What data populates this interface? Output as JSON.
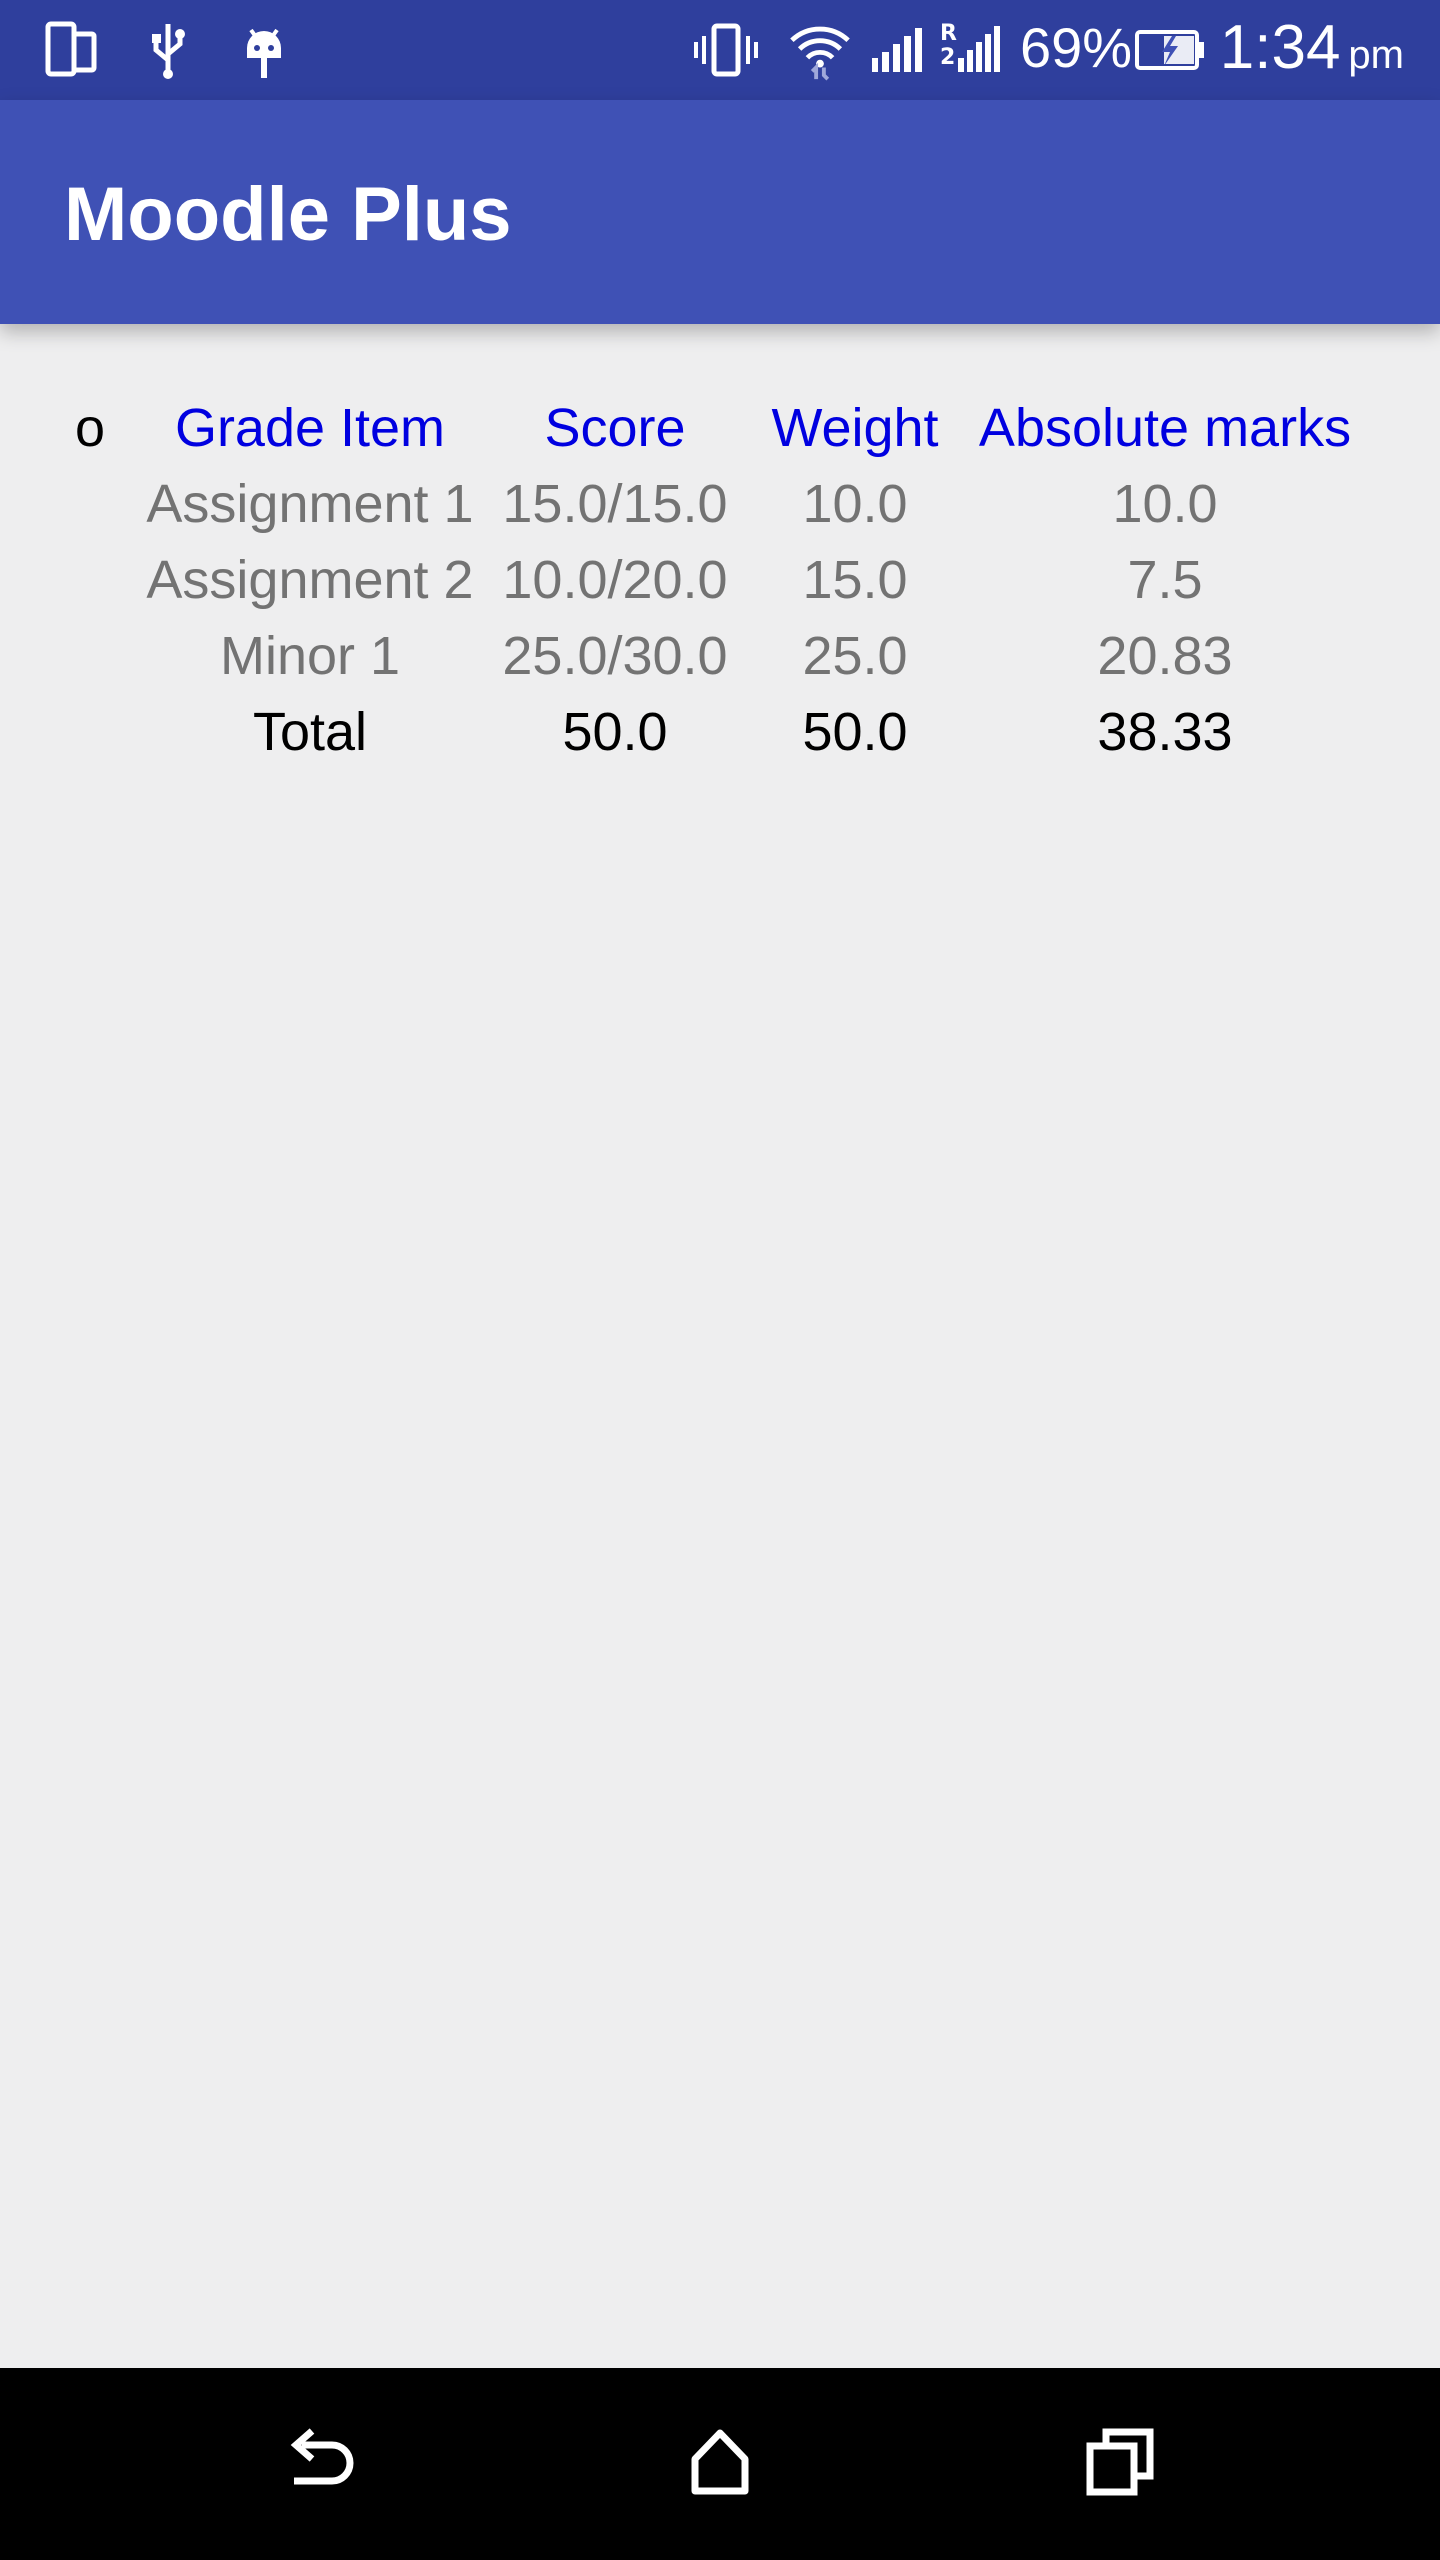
{
  "status_bar": {
    "icons_left": [
      "phone-tablet-icon",
      "usb-icon",
      "android-debug-icon"
    ],
    "icons_right": [
      "vibrate-icon",
      "wifi-icon",
      "signal-1-icon",
      "signal-r-icon",
      "battery-charging-icon"
    ],
    "battery_percent": "69%",
    "time": "1:34",
    "ampm": "pm"
  },
  "app_bar": {
    "title": "Moodle Plus"
  },
  "grades_table": {
    "clipped_column_header": "o",
    "headers": [
      "Grade Item",
      "Score",
      "Weight",
      "Absolute marks"
    ],
    "rows": [
      [
        "Assignment 1",
        "15.0/15.0",
        "10.0",
        "10.0"
      ],
      [
        "Assignment 2",
        "10.0/20.0",
        "15.0",
        "7.5"
      ],
      [
        "Minor 1",
        "25.0/30.0",
        "25.0",
        "20.83"
      ]
    ],
    "total": [
      "Total",
      "50.0",
      "50.0",
      "38.33"
    ]
  },
  "nav_bar": {
    "buttons": [
      "back-icon",
      "home-icon",
      "recents-icon"
    ]
  },
  "colors": {
    "status_bar": "#2f3f9d",
    "app_bar": "#3f51b5",
    "header_text": "#0000e0",
    "data_text": "#737373",
    "background": "#eeeeef"
  }
}
